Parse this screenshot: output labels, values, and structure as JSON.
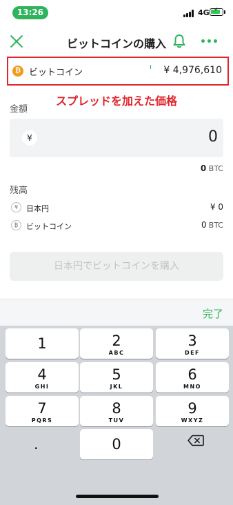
{
  "status_bar": {
    "time": "13:26",
    "network": "4G"
  },
  "header": {
    "title": "ビットコインの購入"
  },
  "price": {
    "asset_name": "ビットコイン",
    "btc_symbol": "₿",
    "value": "¥ 4,976,610"
  },
  "annotation": "スプレッドを加えた価格",
  "amount": {
    "label": "金額",
    "currency_symbol": "¥",
    "value": "0",
    "btc_value": "0",
    "btc_unit": "BTC"
  },
  "balance": {
    "label": "残高",
    "rows": [
      {
        "icon": "¥",
        "name": "日本円",
        "value": "¥ 0",
        "unit": ""
      },
      {
        "icon": "₿",
        "name": "ビットコイン",
        "value": "0",
        "unit": "BTC"
      }
    ]
  },
  "buy_button": "日本円でビットコインを購入",
  "keyboard": {
    "done": "完了",
    "keys": [
      {
        "num": "1",
        "letters": ""
      },
      {
        "num": "2",
        "letters": "ABC"
      },
      {
        "num": "3",
        "letters": "DEF"
      },
      {
        "num": "4",
        "letters": "GHI"
      },
      {
        "num": "5",
        "letters": "JKL"
      },
      {
        "num": "6",
        "letters": "MNO"
      },
      {
        "num": "7",
        "letters": "PQRS"
      },
      {
        "num": "8",
        "letters": "TUV"
      },
      {
        "num": "9",
        "letters": "WXYZ"
      },
      {
        "num": "0",
        "letters": ""
      }
    ],
    "decimal": "."
  },
  "colors": {
    "accent": "#2fb35c",
    "highlight": "#e0252c",
    "bitcoin": "#f29a1c"
  }
}
